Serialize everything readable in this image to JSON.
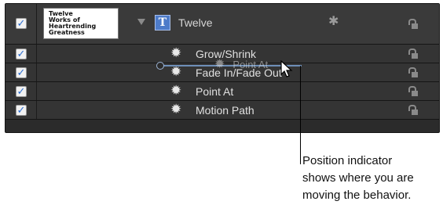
{
  "parent": {
    "thumbnail_lines": [
      "Twelve",
      "Works of",
      "Heartrending",
      "Greatness"
    ],
    "checked": "✓",
    "type_icon": "T",
    "name": "Twelve"
  },
  "behaviors": [
    {
      "name": "Grow/Shrink",
      "checked": "✓"
    },
    {
      "name": "Fade In/Fade Out",
      "checked": "✓"
    },
    {
      "name": "Point At",
      "checked": "✓"
    },
    {
      "name": "Motion Path",
      "checked": "✓"
    }
  ],
  "drag": {
    "ghost_label": "Point At"
  },
  "callout": {
    "lines": [
      "Position indicator",
      "shows where you are",
      "moving the behavior."
    ]
  },
  "icons": {
    "gear": "gear-icon",
    "lock": "lock-icon",
    "disclosure": "disclosure-triangle-icon",
    "cursor": "arrow-cursor-icon"
  },
  "colors": {
    "panel_bg": "#2b2b2b",
    "checkbox_mark": "#2b6dd1",
    "indicator": "#6e8fb8"
  }
}
